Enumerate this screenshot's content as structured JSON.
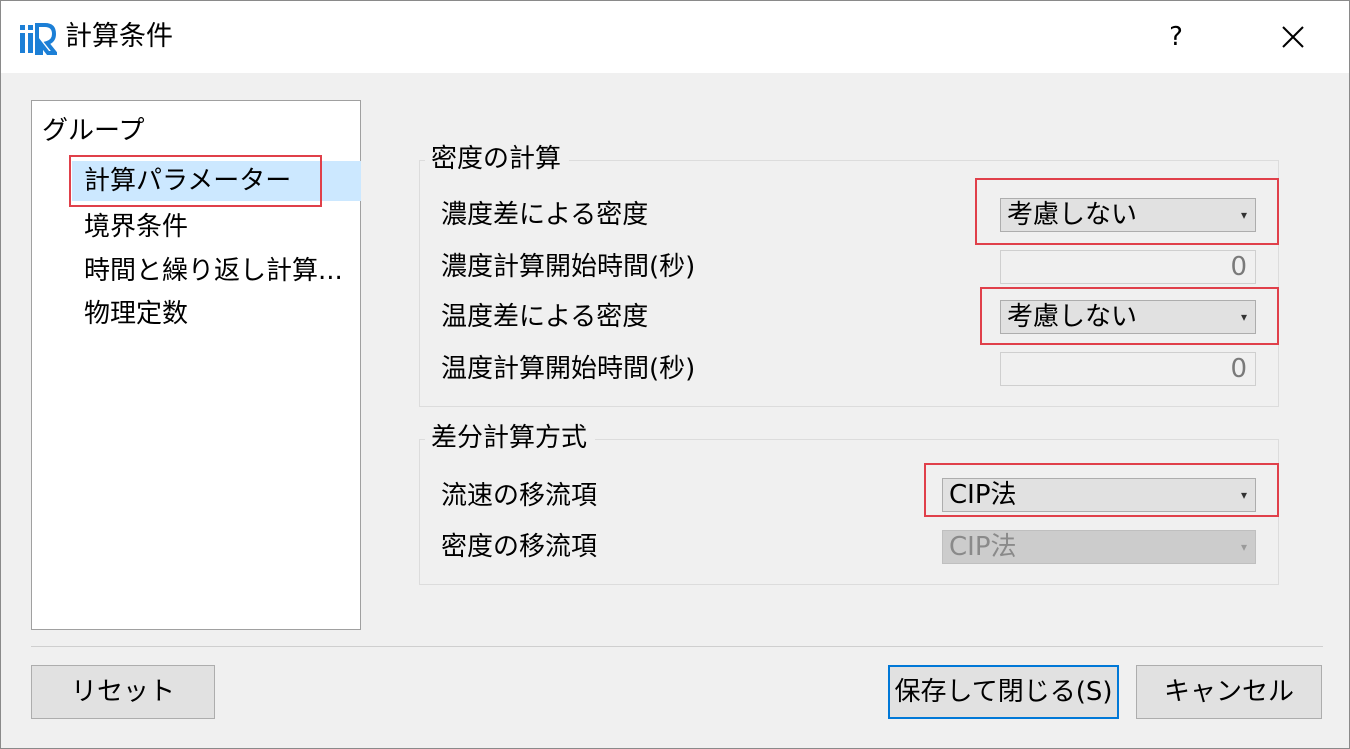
{
  "window": {
    "title": "計算条件",
    "help_label": "?"
  },
  "tree": {
    "root_label": "グループ",
    "items": [
      {
        "label": "計算パラメーター",
        "selected": true
      },
      {
        "label": "境界条件"
      },
      {
        "label": "時間と繰り返し計算..."
      },
      {
        "label": "物理定数"
      }
    ]
  },
  "density_group": {
    "title": "密度の計算",
    "concentration_density_label": "濃度差による密度",
    "concentration_density_value": "考慮しない",
    "concentration_start_label": "濃度計算開始時間(秒)",
    "concentration_start_value": "0",
    "temperature_density_label": "温度差による密度",
    "temperature_density_value": "考慮しない",
    "temperature_start_label": "温度計算開始時間(秒)",
    "temperature_start_value": "0"
  },
  "difference_group": {
    "title": "差分計算方式",
    "velocity_advection_label": "流速の移流項",
    "velocity_advection_value": "CIP法",
    "density_advection_label": "密度の移流項",
    "density_advection_value": "CIP法"
  },
  "buttons": {
    "reset": "リセット",
    "save_close": "保存して閉じる(S)",
    "cancel": "キャンセル"
  },
  "colors": {
    "highlight": "#e0404a",
    "selection": "#cce8ff",
    "default_button_border": "#0078d7"
  },
  "icons": {
    "app": "iric-logo-icon",
    "close": "close-icon",
    "dropdown": "chevron-down-icon"
  }
}
